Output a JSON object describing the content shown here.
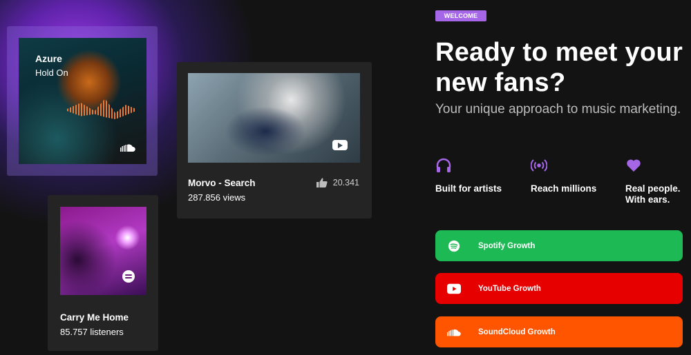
{
  "cards": {
    "azure": {
      "artist": "Azure",
      "track": "Hold On",
      "platform_icon": "soundcloud-icon"
    },
    "morvo": {
      "title": "Morvo - Search",
      "views": "287.856 views",
      "likes": "20.341",
      "platform_icon": "youtube-icon"
    },
    "carry": {
      "title": "Carry Me Home",
      "listeners": "85.757 listeners",
      "platform_icon": "spotify-icon"
    }
  },
  "hero": {
    "badge": "WELCOME",
    "headline": "Ready to meet your new fans?",
    "subhead": "Your unique approach to music marketing."
  },
  "features": [
    {
      "icon": "headphones-icon",
      "label": "Built for artists"
    },
    {
      "icon": "broadcast-icon",
      "label": "Reach millions"
    },
    {
      "icon": "heart-icon",
      "label": "Real people. With ears."
    }
  ],
  "ctas": [
    {
      "label": "Spotify Growth",
      "icon": "spotify-icon",
      "color": "#1db954"
    },
    {
      "label": "YouTube Growth",
      "icon": "youtube-icon",
      "color": "#e60000"
    },
    {
      "label": "SoundCloud Growth",
      "icon": "soundcloud-icon",
      "color": "#ff5500"
    }
  ],
  "colors": {
    "background": "#131313",
    "accent": "#a666e8",
    "card": "#242424"
  }
}
